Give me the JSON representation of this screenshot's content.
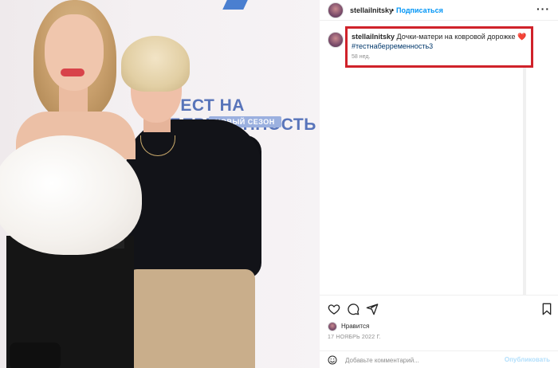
{
  "photo": {
    "backdrop_title": "ТЕСТ НА БЕРЕМЕННОСТЬ 3",
    "backdrop_subtitle": "НОВЫЙ СЕЗОН",
    "backdrop_letters": "К"
  },
  "header": {
    "username": "stellailnitsky",
    "separator": "•",
    "follow_label": "Подписаться",
    "more_icon": "more-horizontal-icon"
  },
  "caption": {
    "username": "stellailnitsky",
    "text": "Дочки-матери на ковровой дорожке ❤️",
    "hashtag": "#тестнаберременность3",
    "time": "58 нед."
  },
  "colors": {
    "highlight_border": "#d0222a",
    "link": "#0095f6",
    "hashtag": "#00376b",
    "muted": "#8e8e8e"
  },
  "actions": {
    "icons": [
      "heart-icon",
      "comment-icon",
      "share-icon",
      "bookmark-icon"
    ]
  },
  "likes": {
    "text": "Нравится"
  },
  "post_date": "17 НОЯБРЬ 2022 Г.",
  "comment": {
    "placeholder": "Добавьте комментарий...",
    "publish_label": "Опубликовать",
    "emoji_icon": "smiley-icon"
  }
}
